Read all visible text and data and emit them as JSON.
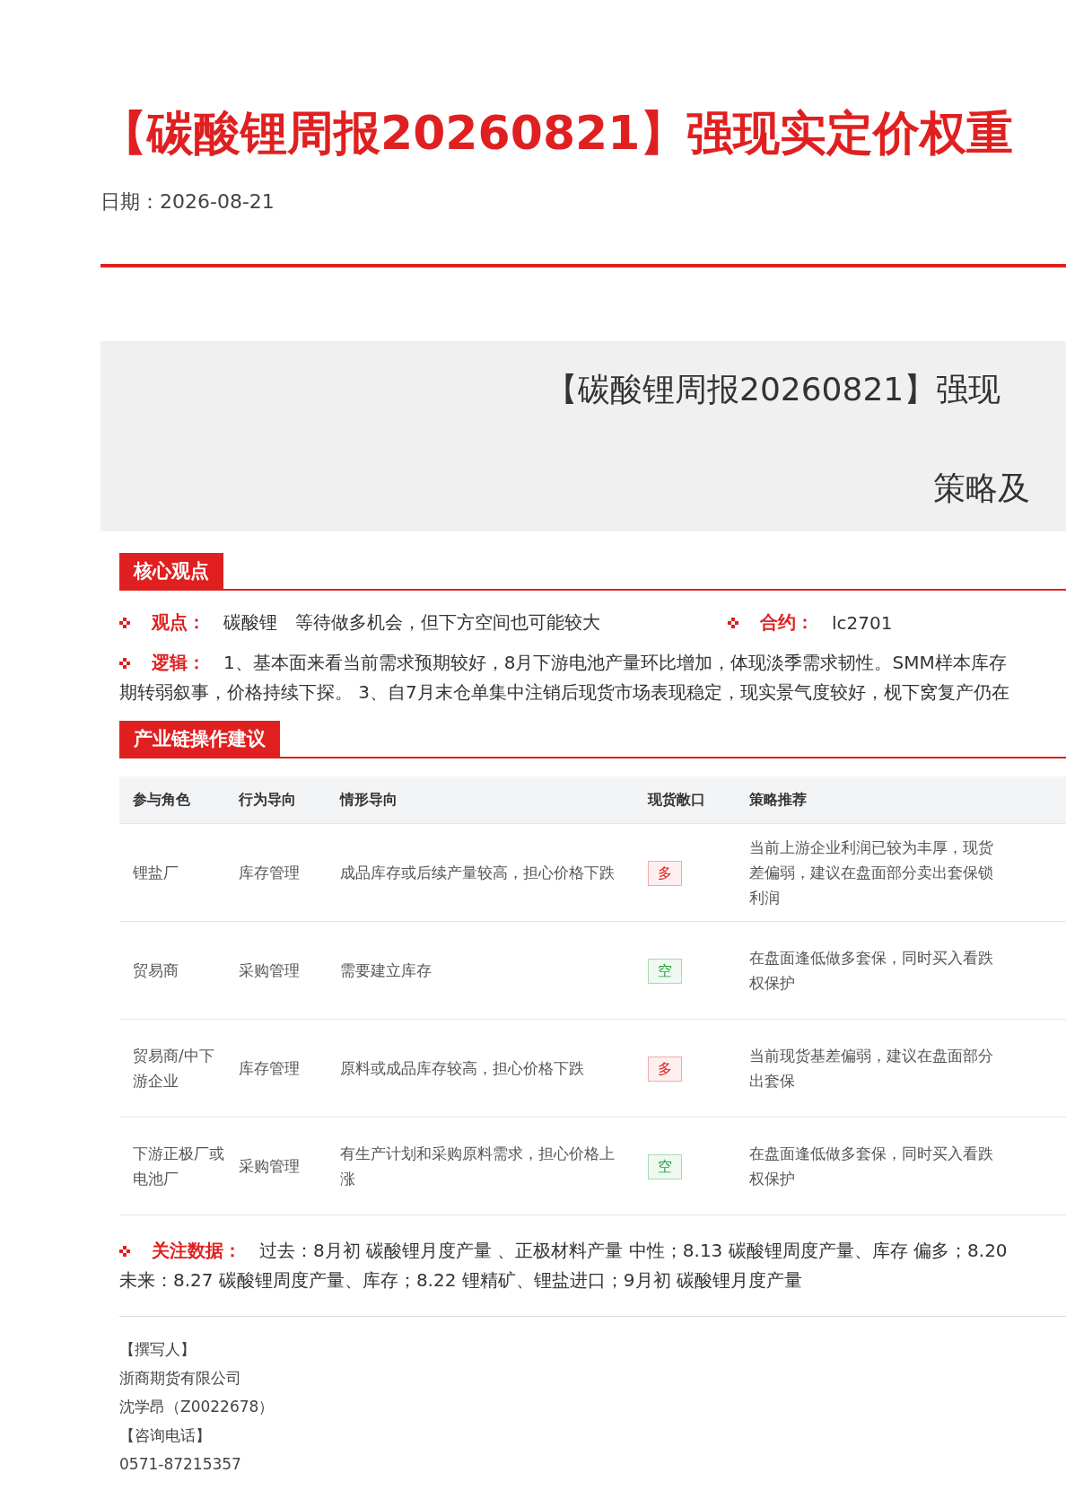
{
  "title": "【碳酸锂周报20260821】强现实定价权重",
  "date": {
    "label": "日期：",
    "value": "2026-08-21"
  },
  "banner": {
    "title": "【碳酸锂周报20260821】强现",
    "subtitle": "策略及"
  },
  "core": {
    "heading": "核心观点",
    "view": {
      "label": "观点：",
      "product": "碳酸锂",
      "text": "等待做多机会，但下方空间也可能较大"
    },
    "contract": {
      "label": "合约：",
      "value": "lc2701"
    },
    "logic": {
      "label": "逻辑：",
      "lines": [
        "1、基本面来看当前需求预期较好，8月下游电池产量环比增加，体现淡季需求韧性。SMM样本库存",
        "期转弱叙事，价格持续下探。 3、自7月末仓单集中注销后现货市场表现稳定，现实景气度较好，枧下窝复产仍在"
      ]
    }
  },
  "chain": {
    "heading": "产业链操作建议",
    "columns": [
      "参与角色",
      "行为导向",
      "情形导向",
      "现货敞口",
      "策略推荐"
    ],
    "rows": [
      {
        "role": "锂盐厂",
        "behavior": "库存管理",
        "situation": "成品库存或后续产量较高，担心价格下跌",
        "exposure": {
          "label": "多",
          "color": "#e02020"
        },
        "strategy": [
          "当前上游企业利润已较为丰厚，现货",
          "差偏弱，建议在盘面部分卖出套保锁",
          "利润"
        ]
      },
      {
        "role": "贸易商",
        "behavior": "采购管理",
        "situation": "需要建立库存",
        "exposure": {
          "label": "空",
          "color": "#22a03a"
        },
        "strategy": [
          "在盘面逢低做多套保，同时买入看跌",
          "权保护"
        ]
      },
      {
        "role": "贸易商/中下游企业",
        "behavior": "库存管理",
        "situation": "原料或成品库存较高，担心价格下跌",
        "exposure": {
          "label": "多",
          "color": "#e02020"
        },
        "strategy": [
          "当前现货基差偏弱，建议在盘面部分",
          "出套保"
        ]
      },
      {
        "role": "下游正极厂或电池厂",
        "behavior": "采购管理",
        "situation": "有生产计划和采购原料需求，担心价格上涨",
        "exposure": {
          "label": "空",
          "color": "#22a03a"
        },
        "strategy": [
          "在盘面逢低做多套保，同时买入看跌",
          "权保护"
        ]
      }
    ]
  },
  "focus": {
    "label": "关注数据：",
    "lines": [
      "过去：8月初 碳酸锂月度产量 、正极材料产量 中性；8.13 碳酸锂周度产量、库存 偏多；8.20",
      "未来：8.27 碳酸锂周度产量、库存；8.22 锂精矿、锂盐进口；9月初 碳酸锂月度产量"
    ]
  },
  "footer": [
    "【撰写人】",
    "浙商期货有限公司",
    "沈学昂（Z0022678）",
    "【咨询电话】",
    "0571-87215357"
  ]
}
